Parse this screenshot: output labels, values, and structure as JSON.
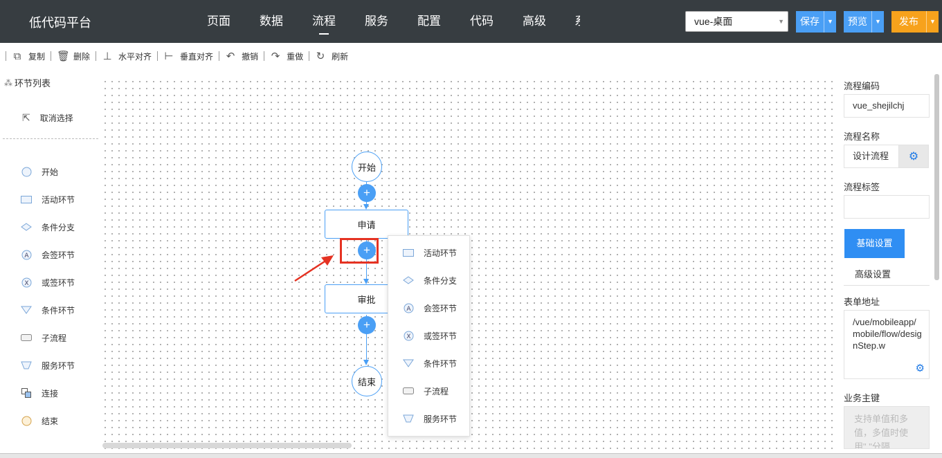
{
  "header": {
    "brand": "低代码平台",
    "nav": [
      "页面",
      "数据",
      "流程",
      "服务",
      "配置",
      "代码",
      "高级"
    ],
    "active_nav": "流程",
    "nav_overflow": "系",
    "platform_select": "vue-桌面",
    "save_label": "保存",
    "preview_label": "预览",
    "publish_label": "发布",
    "colors": {
      "bar": "#373d41",
      "primary": "#4a9ff5",
      "publish": "#f7a21c"
    }
  },
  "toolbar": {
    "copy": "复制",
    "delete": "删除",
    "h_align": "水平对齐",
    "v_align": "垂直对齐",
    "undo": "撤销",
    "redo": "重做",
    "refresh": "刷新"
  },
  "left": {
    "title": "环节列表",
    "cancel_select": "取消选择",
    "items": [
      {
        "label": "开始",
        "icon": "circle-icon"
      },
      {
        "label": "活动环节",
        "icon": "rect-icon"
      },
      {
        "label": "条件分支",
        "icon": "diamond-icon"
      },
      {
        "label": "会签环节",
        "icon": "countersign-icon"
      },
      {
        "label": "或签环节",
        "icon": "or-sign-icon"
      },
      {
        "label": "条件环节",
        "icon": "triangle-icon"
      },
      {
        "label": "子流程",
        "icon": "subprocess-icon"
      },
      {
        "label": "服务环节",
        "icon": "trapezoid-icon"
      },
      {
        "label": "连接",
        "icon": "link-icon"
      },
      {
        "label": "结束",
        "icon": "end-circle-icon"
      }
    ]
  },
  "canvas": {
    "start": "开始",
    "apply": "申请",
    "approve": "审批",
    "end": "结束",
    "plus": "+"
  },
  "popup": {
    "items": [
      {
        "label": "活动环节",
        "icon": "rect-icon"
      },
      {
        "label": "条件分支",
        "icon": "diamond-icon"
      },
      {
        "label": "会签环节",
        "icon": "countersign-icon"
      },
      {
        "label": "或签环节",
        "icon": "or-sign-icon"
      },
      {
        "label": "条件环节",
        "icon": "triangle-icon"
      },
      {
        "label": "子流程",
        "icon": "subprocess-icon"
      },
      {
        "label": "服务环节",
        "icon": "trapezoid-icon"
      }
    ]
  },
  "right": {
    "code_label": "流程编码",
    "code_value": "vue_shejilchj",
    "name_label": "流程名称",
    "name_value": "设计流程",
    "tag_label": "流程标签",
    "tag_value": "",
    "tab_basic": "基础设置",
    "tab_advanced": "高级设置",
    "form_url_label": "表单地址",
    "form_url_value": "/vue/mobileapp/mobile/flow/designStep.w",
    "biz_key_label": "业务主键",
    "biz_key_placeholder": "支持单值和多值，多值时使用\",\"分隔"
  }
}
